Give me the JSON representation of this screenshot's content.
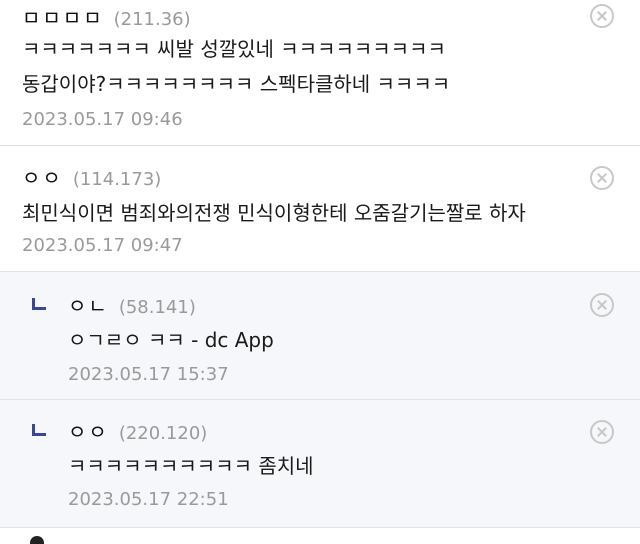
{
  "comments": [
    {
      "nick": "ㅁㅁㅁㅁ",
      "ip": "(211.36)",
      "lines": [
        "ㅋㅋㅋㅋㅋㅋㅋ 씨발 성깔있네 ㅋㅋㅋㅋㅋㅋㅋㅋㅋ",
        "동갑이야?ㅋㅋㅋㅋㅋㅋㅋㅋ 스펙타클하네 ㅋㅋㅋㅋ"
      ],
      "date": "2023.05.17 09:46",
      "is_reply": false
    },
    {
      "nick": "ㅇㅇ",
      "ip": "(114.173)",
      "lines": [
        "최민식이면 범죄와의전쟁 민식이형한테 오줌갈기는짤로 하자"
      ],
      "date": "2023.05.17 09:47",
      "is_reply": false
    },
    {
      "nick": "ㅇㄴ",
      "ip": "(58.141)",
      "lines": [
        "ㅇㄱㄹㅇ ㅋㅋ - dc App"
      ],
      "date": "2023.05.17 15:37",
      "is_reply": true
    },
    {
      "nick": "ㅇㅇ",
      "ip": "(220.120)",
      "lines": [
        "ㅋㅋㅋㅋㅋㅋㅋㅋㅋㅋ 좀치네"
      ],
      "date": "2023.05.17 22:51",
      "is_reply": true
    }
  ],
  "icons": {
    "delete": "close-circle-icon",
    "reply": "reply-arrow-icon"
  },
  "colors": {
    "reply_background": "#f6f7fb",
    "reply_arrow": "#3b4890",
    "meta_text": "#9a9a9a"
  }
}
